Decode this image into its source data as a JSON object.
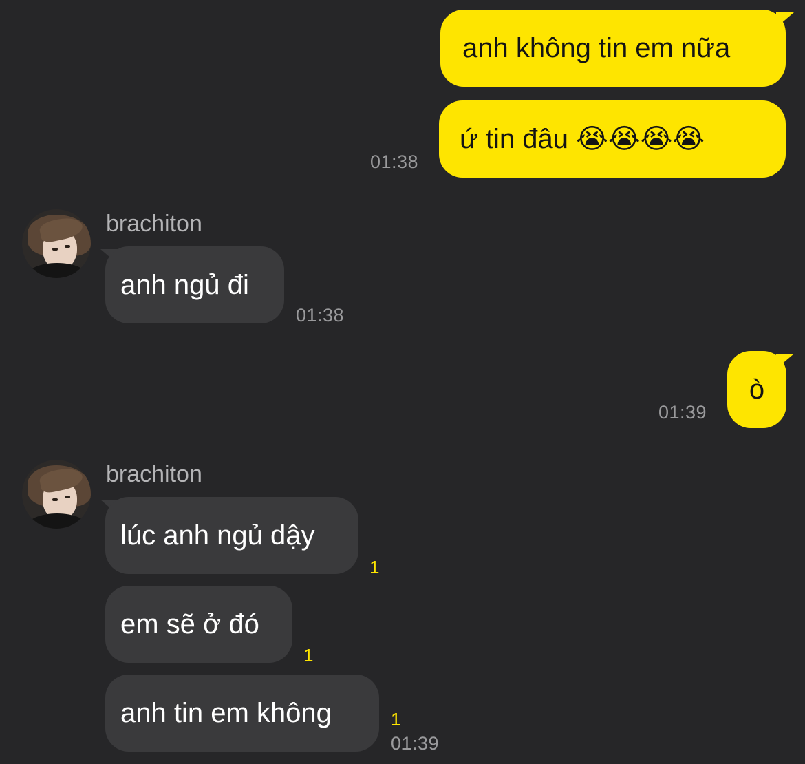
{
  "messages": {
    "out1": {
      "text": "anh không tin em nữa"
    },
    "out2": {
      "text": "ứ tin đâu 😭😭😭😭",
      "time": "01:38"
    },
    "in1": {
      "sender": "brachiton",
      "text": "anh ngủ đi",
      "time": "01:38"
    },
    "out3": {
      "text": "ò",
      "time": "01:39"
    },
    "in2": {
      "sender": "brachiton",
      "text": "lúc anh ngủ dậy",
      "unread": "1"
    },
    "in3": {
      "text": "em sẽ ở đó",
      "unread": "1"
    },
    "in4": {
      "text": "anh tin em không",
      "unread": "1",
      "time": "01:39"
    }
  },
  "colors": {
    "background": "#262628",
    "outgoing_bubble": "#fee500",
    "incoming_bubble": "#3a3a3c",
    "unread_count": "#fee500"
  },
  "icons": {
    "emoji": "loudly-crying-face",
    "avatar": "user-avatar-photo"
  }
}
